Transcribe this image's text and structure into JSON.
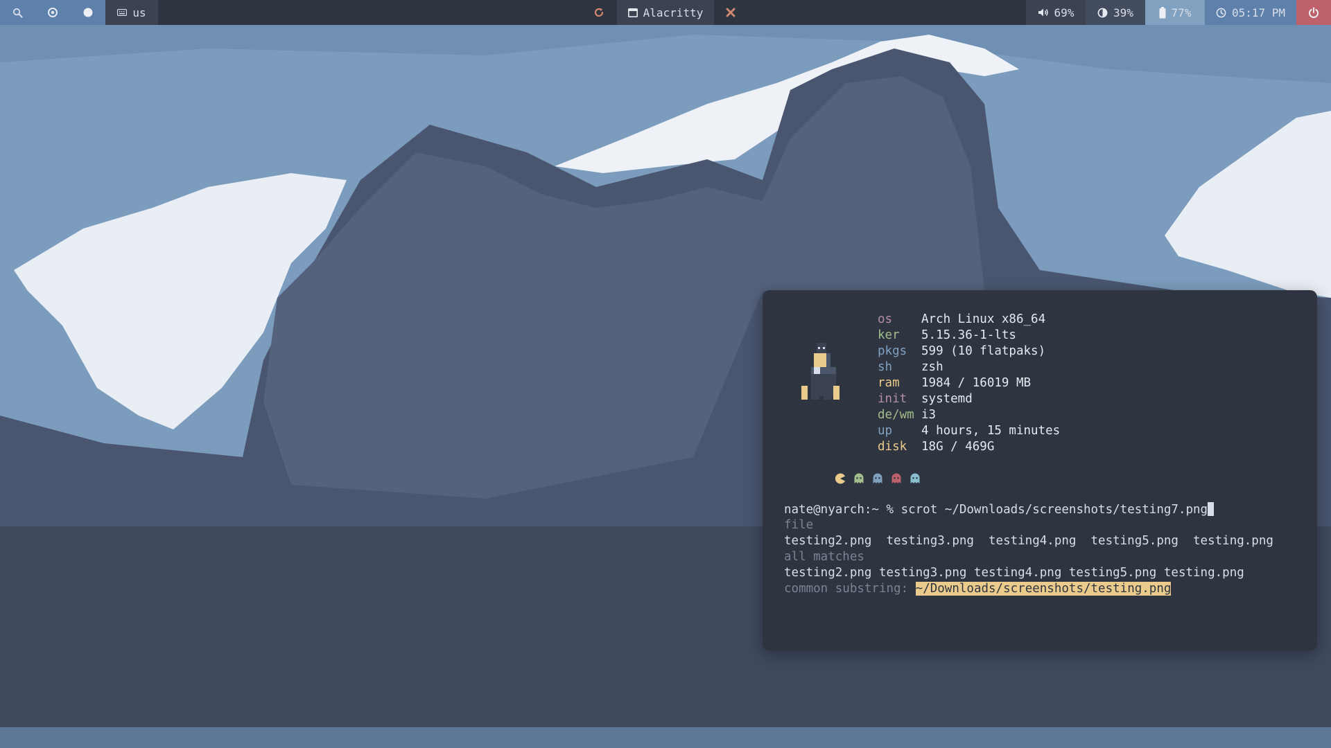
{
  "topbar": {
    "keyboard_layout": "us",
    "active_window": "Alacritty",
    "volume": "69%",
    "brightness": "39%",
    "battery": "77%",
    "clock": "05:17 PM",
    "icons": {
      "search": "search-icon",
      "workspace_1": "target-icon",
      "workspace_2": "dot-icon",
      "keyboard": "keyboard-icon",
      "reload": "reload-icon",
      "window": "window-icon",
      "close": "close-icon",
      "volume": "speaker-icon",
      "brightness": "brightness-icon",
      "battery": "battery-icon",
      "clock": "clock-icon",
      "power": "power-icon"
    }
  },
  "colors": {
    "bar_bg": "#2e3440",
    "accent_blue": "#5e81ac",
    "accent_cyan": "#81a1c1",
    "power_red": "#bf616a",
    "close_red": "#d08770",
    "highlight": "#ebcb8b"
  },
  "fetch": {
    "rows": [
      {
        "key": "os",
        "value": "Arch Linux x86_64"
      },
      {
        "key": "ker",
        "value": "5.15.36-1-lts"
      },
      {
        "key": "pkgs",
        "value": "599 (10 flatpaks)"
      },
      {
        "key": "sh",
        "value": "zsh"
      },
      {
        "key": "ram",
        "value": "1984 / 16019 MB"
      },
      {
        "key": "init",
        "value": "systemd"
      },
      {
        "key": "de/wm",
        "value": "i3"
      },
      {
        "key": "up",
        "value": "4 hours, 15 minutes"
      },
      {
        "key": "disk",
        "value": "18G / 469G"
      }
    ],
    "palette_icons": [
      "pacman-icon",
      "ghost-icon",
      "ghost-icon",
      "ghost-icon",
      "ghost-icon"
    ]
  },
  "terminal": {
    "prompt": "nate@nyarch:~ % ",
    "command": "scrot ~/Downloads/screenshots/testing7.png",
    "file_header": "file",
    "file_list": "testing2.png  testing3.png  testing4.png  testing5.png  testing.png",
    "matches_header": "all matches",
    "matches_list": "testing2.png testing3.png testing4.png testing5.png testing.png",
    "common_label": "common substring: ",
    "common_value": "~/Downloads/screenshots/testing.png"
  }
}
